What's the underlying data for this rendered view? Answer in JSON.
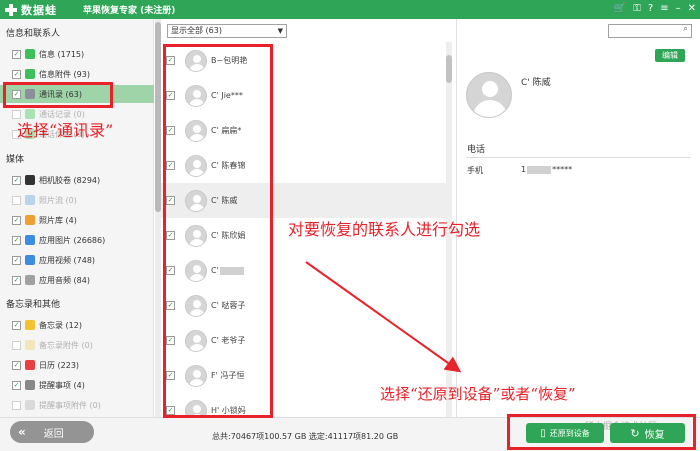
{
  "titlebar": {
    "brand": "数据蛙",
    "app_title": "苹果恢复专家 (未注册)",
    "icons": [
      "cart-icon",
      "key-icon",
      "question-icon",
      "menu-icon",
      "minimize-icon",
      "close-icon"
    ],
    "icon_glyphs": [
      "🛒",
      "⚿",
      "?",
      "≡",
      "–",
      "✕"
    ]
  },
  "sidebar": {
    "section1": "信息和联系人",
    "section2": "媒体",
    "section3": "备忘录和其他",
    "items": [
      {
        "label": "信息 (1715)",
        "checked": true,
        "faded": false,
        "icon_color": "#3dbf5a"
      },
      {
        "label": "信息附件 (93)",
        "checked": true,
        "faded": false,
        "icon_color": "#3dbf5a"
      },
      {
        "label": "通讯录 (63)",
        "checked": true,
        "faded": false,
        "icon_color": "#8a8f99",
        "active": true
      },
      {
        "label": "通话记录 (0)",
        "checked": false,
        "faded": true,
        "icon_color": "#5fcf74"
      },
      {
        "label": "通话传输 (0)",
        "checked": false,
        "faded": true,
        "icon_color": "#5fcf74"
      },
      {
        "label": "相机胶卷 (8294)",
        "checked": true,
        "faded": false,
        "icon_color": "#333333"
      },
      {
        "label": "照片流 (0)",
        "checked": false,
        "faded": true,
        "icon_color": "#7fb0e0"
      },
      {
        "label": "照片库 (4)",
        "checked": true,
        "faded": false,
        "icon_color": "#f0a030"
      },
      {
        "label": "应用图片 (26686)",
        "checked": true,
        "faded": false,
        "icon_color": "#3c8de0"
      },
      {
        "label": "应用视频 (748)",
        "checked": true,
        "faded": false,
        "icon_color": "#3c8de0"
      },
      {
        "label": "应用音频 (84)",
        "checked": true,
        "faded": false,
        "icon_color": "#a0a0a0"
      },
      {
        "label": "备忘录 (12)",
        "checked": true,
        "faded": false,
        "icon_color": "#f2c230"
      },
      {
        "label": "备忘录附件 (0)",
        "checked": false,
        "faded": true,
        "icon_color": "#f2d780"
      },
      {
        "label": "日历 (223)",
        "checked": true,
        "faded": false,
        "icon_color": "#e84040"
      },
      {
        "label": "提醒事项 (4)",
        "checked": true,
        "faded": false,
        "icon_color": "#888888"
      },
      {
        "label": "提醒事项附件 (0)",
        "checked": false,
        "faded": true,
        "icon_color": "#c0c0c0"
      }
    ]
  },
  "list": {
    "filter": "显示全部 (63)",
    "contacts": [
      {
        "name": "B~包明艳",
        "checked": true
      },
      {
        "name": "C' Jie***",
        "checked": true
      },
      {
        "name": "C' 扁扁*",
        "checked": true
      },
      {
        "name": "C' 陈春锦",
        "checked": true
      },
      {
        "name": "C' 陈威",
        "checked": true,
        "selected": true
      },
      {
        "name": "C' 陈欣娟",
        "checked": true
      },
      {
        "name": "C'",
        "checked": true,
        "blurred": true
      },
      {
        "name": "C' 哒蓉子",
        "checked": true
      },
      {
        "name": "C' 老爷子",
        "checked": true
      },
      {
        "name": "F' 冯子恒",
        "checked": true
      },
      {
        "name": "H' 小锁妈",
        "checked": true
      }
    ]
  },
  "detail": {
    "edit_label": "编辑",
    "name": "C' 陈威",
    "phone_section": "电话",
    "mobile_label": "手机",
    "mobile_prefix": "1",
    "mobile_suffix": "*****"
  },
  "bottom": {
    "back_label": "返回",
    "totals": "总共:70467项100.57 GB 选定:41117项81.20 GB",
    "restore_device_label": "还原到设备",
    "restore_label": "恢复",
    "watermark": "@稀土掘金技术社区"
  },
  "annotations": {
    "select_contacts": "选择“通讯录”",
    "check_contacts": "对要恢复的联系人进行勾选",
    "choose_restore": "选择“还原到设备”或者“恢复”",
    "color": "#e8222a"
  }
}
